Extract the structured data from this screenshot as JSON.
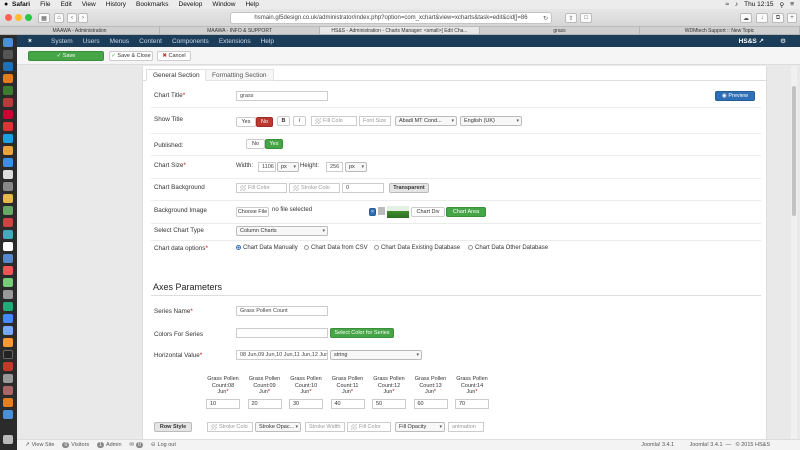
{
  "mac_menu": {
    "app": "Safari",
    "items": [
      "File",
      "Edit",
      "View",
      "History",
      "Bookmarks",
      "Develop",
      "Window",
      "Help"
    ],
    "clock": "Thu 12:15"
  },
  "browser": {
    "url": "hsmain.gl5design.co.uk/administrator/index.php?option=com_xchart&view=xcharts&task=edit&cid[]=86",
    "tabs": [
      "MAAWA - Administration",
      "MAAWA - INFO & SUPPORT",
      "HS&S - Administration - Charts Manager: <small>[ Edit Cha...",
      "grass",
      "WDMtech Support :: New Topic"
    ],
    "active_tab": 2
  },
  "admin_nav": {
    "items": [
      "System",
      "Users",
      "Menus",
      "Content",
      "Components",
      "Extensions",
      "Help"
    ],
    "site": "HS&S"
  },
  "toolbar": {
    "save": "Save",
    "save_close": "Save & Close",
    "cancel": "Cancel"
  },
  "form_tabs": {
    "general": "General Section",
    "formatting": "Formatting Section"
  },
  "general": {
    "chart_title_label": "Chart Title",
    "chart_title_value": "grass",
    "preview": "Preview",
    "show_title_label": "Show Title",
    "yes": "Yes",
    "no": "No",
    "bold": "B",
    "italic": "I",
    "fill_color_ph": "Fill Colo",
    "font_size_ph": "Font Size",
    "font_family": "Abadi MT Cond...",
    "language": "English (UK)",
    "published_label": "Published:",
    "chart_size_label": "Chart Size",
    "width_label": "Width:",
    "width_value": "1106",
    "width_unit": "px",
    "height_label": "Height:",
    "height_value": "256",
    "height_unit": "px",
    "chart_bg_label": "Chart Background",
    "bg_fill_ph": "Fill Color",
    "bg_stroke_ph": "Stroke Colo",
    "bg_stroke_width": "0",
    "transparent": "Transparent",
    "bg_image_label": "Background Image",
    "choose_file": "Choose File",
    "no_file": "no file selected",
    "chart_div": "Chart Div",
    "chart_area": "Chart Area",
    "chart_type_label": "Select Chart Type",
    "chart_type_value": "Column Charts",
    "data_options_label": "Chart data options",
    "data_options": [
      "Chart Data Manually",
      "Chart Data from CSV",
      "Chart Data Existing Database",
      "Chart Data Other Database"
    ]
  },
  "axes": {
    "heading": "Axes Parameters",
    "series_name_label": "Series Name",
    "series_name_value": "Grass Pollen Count",
    "colors_label": "Colors For Series",
    "select_color": "Select Color for Series",
    "horizontal_label": "Horizontal Value",
    "horizontal_value": "08 Jun,09 Jun,10 Jun,11 Jun,12 Jun,13",
    "horizontal_type": "string",
    "columns": [
      {
        "line1": "Grass Pollen",
        "line2": "Count:08",
        "line3": "Jun",
        "value": "10"
      },
      {
        "line1": "Grass Pollen",
        "line2": "Count:09",
        "line3": "Jun",
        "value": "20"
      },
      {
        "line1": "Grass Pollen",
        "line2": "Count:10",
        "line3": "Jun",
        "value": "30"
      },
      {
        "line1": "Grass Pollen",
        "line2": "Count:11",
        "line3": "Jun",
        "value": "40"
      },
      {
        "line1": "Grass Pollen",
        "line2": "Count:12",
        "line3": "Jun",
        "value": "50"
      },
      {
        "line1": "Grass Pollen",
        "line2": "Count:13",
        "line3": "Jun",
        "value": "60"
      },
      {
        "line1": "Grass Pollen",
        "line2": "Count:14",
        "line3": "Jun",
        "value": "70"
      }
    ],
    "row_style": "Row Style",
    "row_stroke_ph": "Stroke Colo",
    "row_stroke_opacity": "Stroke Opac...",
    "row_stroke_width_ph": "Stroke Width",
    "row_fill_ph": "Fill Color",
    "row_fill_opacity": "Fill Opacity",
    "row_animation_ph": "animation"
  },
  "status_bar": {
    "view_site": "View Site",
    "visitors_count": "0",
    "visitors": "Visitors",
    "admin_count": "1",
    "admin": "Admin",
    "msg_count": "0",
    "logout": "Log out",
    "version1": "Joomla! 3.4.1",
    "version2": "Joomla! 3.4.1",
    "copyright": "© 2015 HS&S"
  },
  "colors": {
    "nav_bg": "#1c3d5a",
    "success": "#46a546",
    "danger": "#bd362f",
    "primary": "#2f6fb5"
  }
}
